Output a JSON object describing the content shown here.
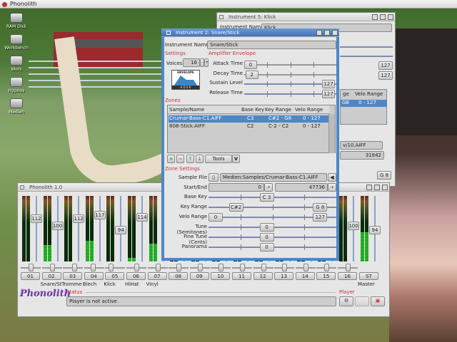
{
  "topbar": {
    "title": "Phonolith"
  },
  "desktop": {
    "icons": [
      "RAM Disk",
      "Workbench",
      "Work",
      "Hypnos",
      "Medien"
    ]
  },
  "klick_window": {
    "title": "Instrument 5: Klick",
    "instrument_name_label": "Instrument Name",
    "instrument_name": "Klick",
    "sustain": "127",
    "release": "127",
    "col_key_range_fragment": "ge",
    "col_velo_range": "Velo Range",
    "row_key_fragment": "G8",
    "row_velo": "0 - 127",
    "sample_fragment": "v/10.AIFF",
    "end_value": "31842",
    "key_range_high": "G 8"
  },
  "instrument_window": {
    "title": "Instrument 2: Snare/Stick",
    "instrument_name_label": "Instrument Name",
    "instrument_name": "Snare/Stick",
    "settings_label": "Settings",
    "voices_label": "Voices",
    "voices": "16",
    "envelope_image_label": "ENVELOPE",
    "envelope_letters": "A D S R",
    "amp_label": "Amplifier Envelope",
    "envelope": [
      {
        "label": "Attack Time",
        "value": "0",
        "fraction": 0
      },
      {
        "label": "Decay Time",
        "value": "2",
        "fraction": 0.016
      },
      {
        "label": "Sustain Level",
        "value": "127",
        "fraction": 1
      },
      {
        "label": "Release Time",
        "value": "127",
        "fraction": 1
      }
    ],
    "zones_label": "Zones",
    "zones_columns": [
      "Sample/Name",
      "Base Key",
      "Key Range",
      "Velo Range"
    ],
    "zones": [
      {
        "name": "Crumar-Bass-C1.AIFF",
        "base": "C3",
        "range": "C#2 - G8",
        "velo": "0 - 127",
        "selected": true
      },
      {
        "name": "808-Stick.AIFF",
        "base": "C2",
        "range": "C-2 - C2",
        "velo": "0 - 127",
        "selected": false
      }
    ],
    "tools_label": "Tools",
    "tools_arrow": "V",
    "zone_settings_label": "Zone Settings",
    "sample_file_label": "Sample File",
    "sample_file": "Medien:Samples/Crumar-Bass-C1.AIFF",
    "start_end_label": "Start/End",
    "start": "0",
    "end": "47736",
    "base_key_label": "Base Key",
    "base_key": "C 3",
    "key_range_label": "Key Range",
    "key_low": "C#2",
    "key_high": "G 8",
    "velo_range_label": "Velo Range",
    "velo_low": "0",
    "velo_high": "127",
    "tune_label": "Tune (Semitones)",
    "tune": "0",
    "fine_label": "Fine Tune (Cents)",
    "fine": "0",
    "pan_label": "Panorama",
    "pan": "0"
  },
  "mixer": {
    "title": "Phonolith 1.0",
    "logo": "Phonolith",
    "channels": [
      {
        "id": "01",
        "name": "",
        "volume": "112",
        "level": 0,
        "pan": 0.5
      },
      {
        "id": "02",
        "name": "Snare/St",
        "volume": "100",
        "level": 0.25,
        "pan": 0.5
      },
      {
        "id": "03",
        "name": "Tromme",
        "volume": "112",
        "level": 0,
        "pan": 0.6
      },
      {
        "id": "04",
        "name": "Blech",
        "volume": "117",
        "level": 0.32,
        "pan": 0.4
      },
      {
        "id": "05",
        "name": "Klick",
        "volume": "94",
        "level": 0,
        "pan": 0.2
      },
      {
        "id": "06",
        "name": "HiHat",
        "volume": "114",
        "level": 0.05,
        "pan": 0.5
      },
      {
        "id": "07",
        "name": "Vinyl",
        "volume": "",
        "level": 0.27,
        "pan": 0.5
      },
      {
        "id": "08",
        "name": "",
        "volume": "",
        "level": 0,
        "pan": 0.5
      },
      {
        "id": "09",
        "name": "",
        "volume": "",
        "level": 0,
        "pan": 0.5
      },
      {
        "id": "10",
        "name": "",
        "volume": "",
        "level": 0,
        "pan": 0.5
      },
      {
        "id": "11",
        "name": "",
        "volume": "",
        "level": 0,
        "pan": 0.5
      },
      {
        "id": "12",
        "name": "",
        "volume": "",
        "level": 0,
        "pan": 0.5
      },
      {
        "id": "13",
        "name": "",
        "volume": "",
        "level": 0,
        "pan": 0.5
      },
      {
        "id": "14",
        "name": "",
        "volume": "",
        "level": 0,
        "pan": 0.5
      },
      {
        "id": "15",
        "name": "",
        "volume": "",
        "level": 0,
        "pan": 0.5
      },
      {
        "id": "16",
        "name": "",
        "volume": "100",
        "level": 0,
        "pan": 0.5
      }
    ],
    "master": {
      "id": "ST",
      "name": "Master",
      "volume": "94",
      "level": 0.45
    },
    "status_label": "Status",
    "status": "Player is not active",
    "player_label": "Player"
  }
}
